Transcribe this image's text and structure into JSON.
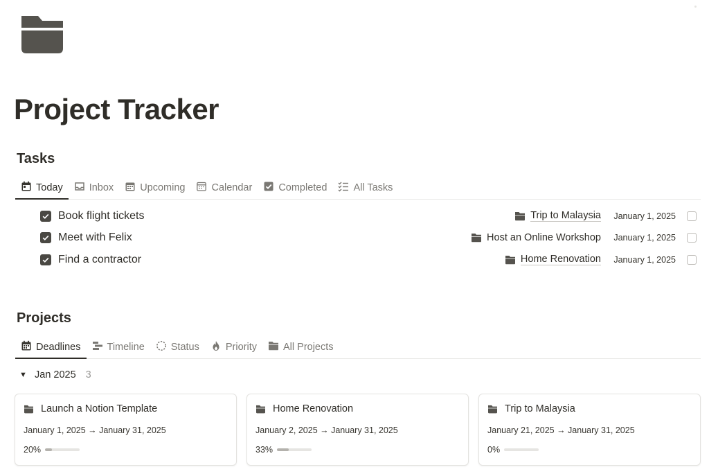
{
  "page": {
    "title": "Project Tracker",
    "icon": "folder-icon"
  },
  "tasks": {
    "heading": "Tasks",
    "tabs": [
      {
        "label": "Today",
        "icon": "calendar-day-icon",
        "active": true
      },
      {
        "label": "Inbox",
        "icon": "inbox-tray-icon",
        "active": false
      },
      {
        "label": "Upcoming",
        "icon": "calendar-grid-icon",
        "active": false
      },
      {
        "label": "Calendar",
        "icon": "calendar-outline-icon",
        "active": false
      },
      {
        "label": "Completed",
        "icon": "checkbox-icon",
        "active": false
      },
      {
        "label": "All Tasks",
        "icon": "checklist-icon",
        "active": false
      }
    ],
    "items": [
      {
        "name": "Book flight tickets",
        "project": "Trip to Malaysia",
        "project_underlined": true,
        "date": "January 1, 2025",
        "checked": true
      },
      {
        "name": "Meet with Felix",
        "project": "Host an Online Workshop",
        "project_underlined": false,
        "date": "January 1, 2025",
        "checked": true
      },
      {
        "name": "Find a contractor",
        "project": "Home Renovation",
        "project_underlined": true,
        "date": "January 1, 2025",
        "checked": true
      }
    ]
  },
  "projects": {
    "heading": "Projects",
    "tabs": [
      {
        "label": "Deadlines",
        "icon": "calendar-day-icon",
        "active": true
      },
      {
        "label": "Timeline",
        "icon": "timeline-icon",
        "active": false
      },
      {
        "label": "Status",
        "icon": "dashed-circle-icon",
        "active": false
      },
      {
        "label": "Priority",
        "icon": "fire-icon",
        "active": false
      },
      {
        "label": "All Projects",
        "icon": "folder-icon",
        "active": false
      }
    ],
    "group": {
      "label": "Jan 2025",
      "count": "3"
    },
    "cards": [
      {
        "title": "Launch a Notion Template",
        "dates": "January 1, 2025 → January 31, 2025",
        "progress_label": "20%",
        "progress": 0.2
      },
      {
        "title": "Home Renovation",
        "dates": "January 2, 2025 → January 31, 2025",
        "progress_label": "33%",
        "progress": 0.33
      },
      {
        "title": "Trip to Malaysia",
        "dates": "January 21, 2025 → January 31, 2025",
        "progress_label": "0%",
        "progress": 0.0
      }
    ]
  },
  "colors": {
    "text": "#2f2d28",
    "muted": "#7a7873",
    "icon": "#55534e",
    "checkbox_fill": "#4a4843",
    "progress_fill": "#b4b2ad",
    "progress_track": "#e6e5e2"
  }
}
